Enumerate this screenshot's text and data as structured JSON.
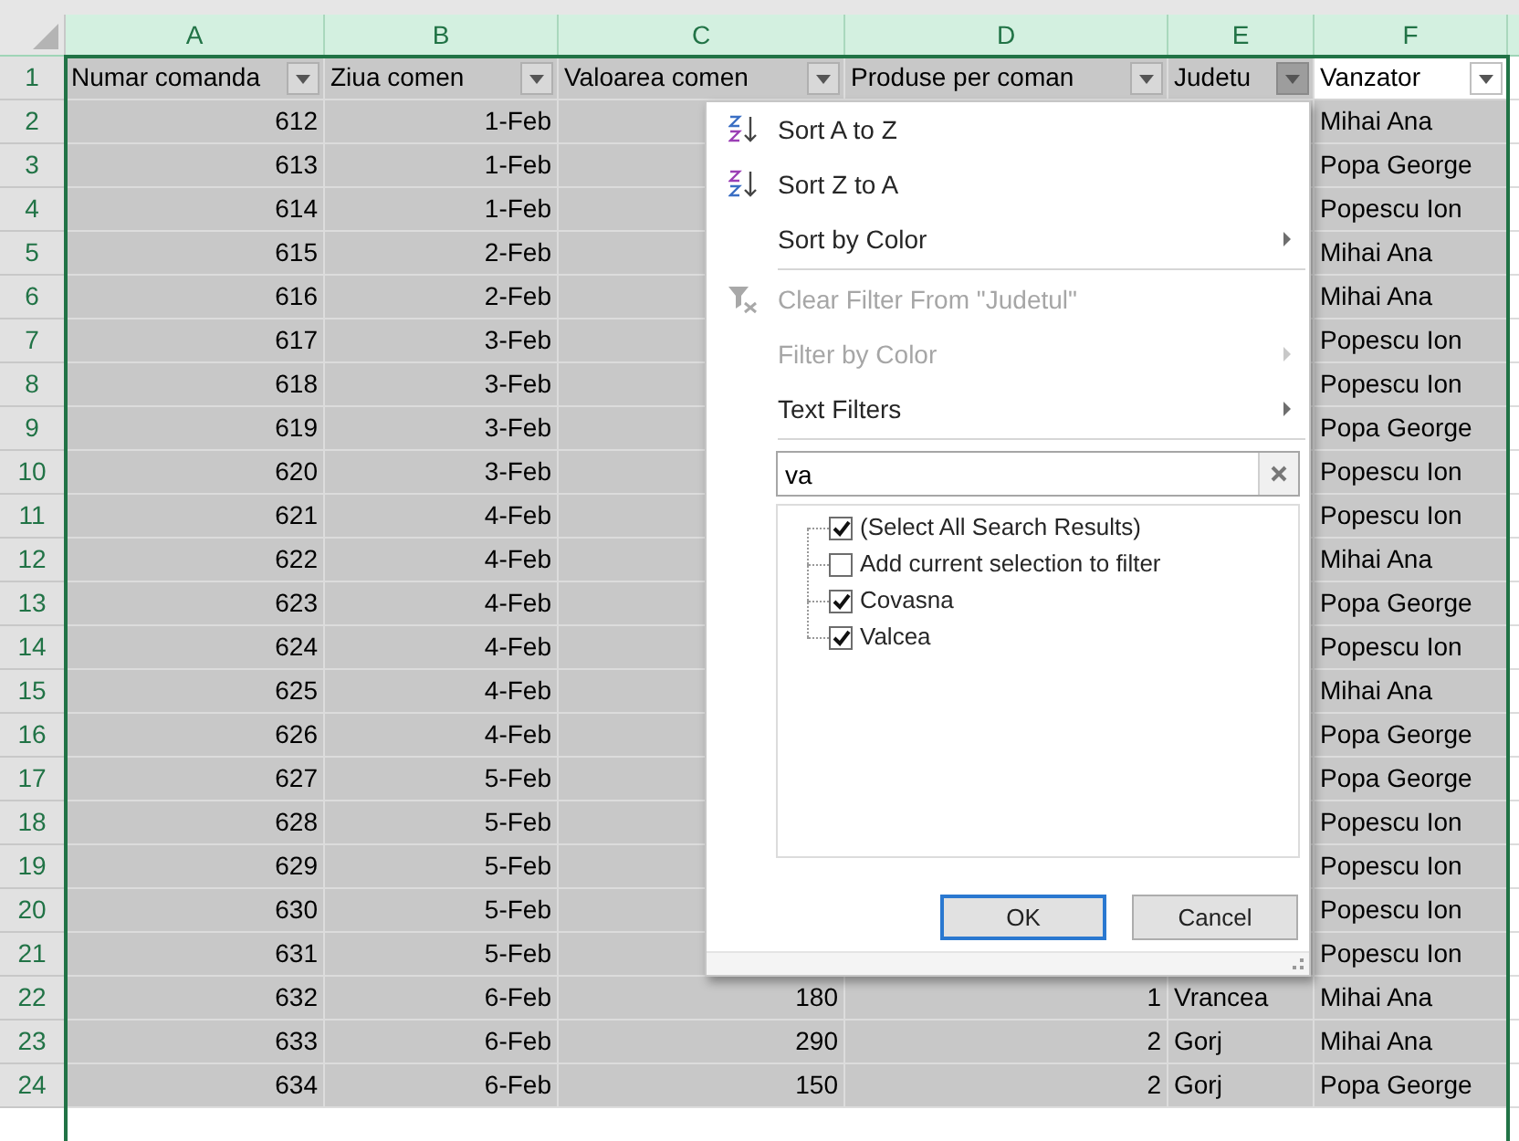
{
  "columns": [
    {
      "letter": "A",
      "kind": "number"
    },
    {
      "letter": "B",
      "kind": "date"
    },
    {
      "letter": "C",
      "kind": "number"
    },
    {
      "letter": "D",
      "kind": "number"
    },
    {
      "letter": "E",
      "kind": "text"
    },
    {
      "letter": "F",
      "kind": "text"
    }
  ],
  "header_row": {
    "number": "1",
    "cells": [
      {
        "text": "Numar comanda",
        "filter_open": false,
        "active": false
      },
      {
        "text": "Ziua comen",
        "filter_open": false,
        "active": false
      },
      {
        "text": "Valoarea comen",
        "filter_open": false,
        "active": false
      },
      {
        "text": "Produse per coman",
        "filter_open": false,
        "active": false
      },
      {
        "text": "Judetu",
        "filter_open": true,
        "active": false
      },
      {
        "text": "Vanzator",
        "filter_open": false,
        "active": true
      }
    ]
  },
  "rows": [
    {
      "number": "2",
      "cells": {
        "A": "612",
        "B": "1-Feb",
        "F": "Mihai Ana"
      }
    },
    {
      "number": "3",
      "cells": {
        "A": "613",
        "B": "1-Feb",
        "F": "Popa George"
      }
    },
    {
      "number": "4",
      "cells": {
        "A": "614",
        "B": "1-Feb",
        "F": "Popescu Ion"
      }
    },
    {
      "number": "5",
      "cells": {
        "A": "615",
        "B": "2-Feb",
        "F": "Mihai Ana"
      }
    },
    {
      "number": "6",
      "cells": {
        "A": "616",
        "B": "2-Feb",
        "F": "Mihai Ana"
      }
    },
    {
      "number": "7",
      "cells": {
        "A": "617",
        "B": "3-Feb",
        "F": "Popescu Ion"
      }
    },
    {
      "number": "8",
      "cells": {
        "A": "618",
        "B": "3-Feb",
        "F": "Popescu Ion"
      }
    },
    {
      "number": "9",
      "cells": {
        "A": "619",
        "B": "3-Feb",
        "F": "Popa George"
      }
    },
    {
      "number": "10",
      "cells": {
        "A": "620",
        "B": "3-Feb",
        "F": "Popescu Ion"
      }
    },
    {
      "number": "11",
      "cells": {
        "A": "621",
        "B": "4-Feb",
        "F": "Popescu Ion"
      }
    },
    {
      "number": "12",
      "cells": {
        "A": "622",
        "B": "4-Feb",
        "F": "Mihai Ana"
      }
    },
    {
      "number": "13",
      "cells": {
        "A": "623",
        "B": "4-Feb",
        "F": "Popa George"
      }
    },
    {
      "number": "14",
      "cells": {
        "A": "624",
        "B": "4-Feb",
        "F": "Popescu Ion"
      }
    },
    {
      "number": "15",
      "cells": {
        "A": "625",
        "B": "4-Feb",
        "F": "Mihai Ana"
      }
    },
    {
      "number": "16",
      "cells": {
        "A": "626",
        "B": "4-Feb",
        "F": "Popa George"
      }
    },
    {
      "number": "17",
      "cells": {
        "A": "627",
        "B": "5-Feb",
        "F": "Popa George"
      }
    },
    {
      "number": "18",
      "cells": {
        "A": "628",
        "B": "5-Feb",
        "F": "Popescu Ion"
      }
    },
    {
      "number": "19",
      "cells": {
        "A": "629",
        "B": "5-Feb",
        "F": "Popescu Ion"
      }
    },
    {
      "number": "20",
      "cells": {
        "A": "630",
        "B": "5-Feb",
        "F": "Popescu Ion"
      }
    },
    {
      "number": "21",
      "cells": {
        "A": "631",
        "B": "5-Feb",
        "F": "Popescu Ion"
      }
    },
    {
      "number": "22",
      "cells": {
        "A": "632",
        "B": "6-Feb",
        "C": "180",
        "D": "1",
        "E": "Vrancea",
        "F": "Mihai Ana"
      }
    },
    {
      "number": "23",
      "cells": {
        "A": "633",
        "B": "6-Feb",
        "C": "290",
        "D": "2",
        "E": "Gorj",
        "F": "Mihai Ana"
      }
    },
    {
      "number": "24",
      "cells": {
        "A": "634",
        "B": "6-Feb",
        "C": "150",
        "D": "2",
        "E": "Gorj",
        "F": "Popa George"
      }
    }
  ],
  "filter_menu": {
    "items": [
      {
        "kind": "sort_asc",
        "label": "Sort A to Z",
        "disabled": false,
        "submenu": false
      },
      {
        "kind": "sort_desc",
        "label": "Sort Z to A",
        "disabled": false,
        "submenu": false
      },
      {
        "kind": "plain",
        "label": "Sort by Color",
        "disabled": false,
        "submenu": true
      },
      {
        "kind": "separator"
      },
      {
        "kind": "clear_filter",
        "label": "Clear Filter From \"Judetul\"",
        "disabled": true,
        "submenu": false
      },
      {
        "kind": "plain",
        "label": "Filter by Color",
        "disabled": true,
        "submenu": true
      },
      {
        "kind": "plain",
        "label": "Text Filters",
        "disabled": false,
        "submenu": true
      },
      {
        "kind": "separator"
      }
    ],
    "search": {
      "value": "va"
    },
    "options": [
      {
        "label": "(Select All Search Results)",
        "checked": true
      },
      {
        "label": "Add current selection to filter",
        "checked": false
      },
      {
        "label": "Covasna",
        "checked": true
      },
      {
        "label": "Valcea",
        "checked": true
      }
    ],
    "buttons": [
      {
        "label": "OK",
        "default": true
      },
      {
        "label": "Cancel",
        "default": false
      }
    ]
  }
}
